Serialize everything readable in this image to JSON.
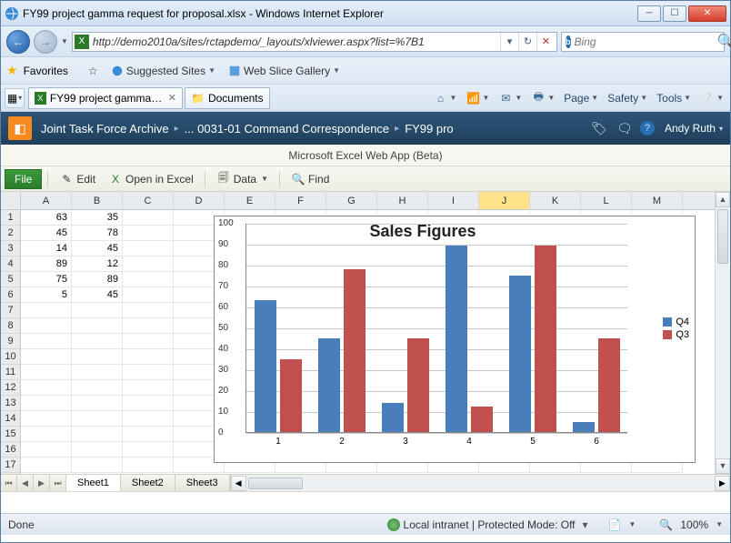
{
  "window": {
    "title": "FY99 project gamma request for proposal.xlsx - Windows Internet Explorer"
  },
  "address": {
    "url": "http://demo2010a/sites/rctapdemo/_layouts/xlviewer.aspx?list=%7B1"
  },
  "search": {
    "placeholder": "Bing"
  },
  "favorites": {
    "label": "Favorites",
    "suggested": "Suggested Sites",
    "webslice": "Web Slice Gallery"
  },
  "tabs": {
    "tab1": "FY99 project gamma re...",
    "tab2": "Documents"
  },
  "commandbar": {
    "page": "Page",
    "safety": "Safety",
    "tools": "Tools"
  },
  "sharepoint": {
    "bc1": "Joint Task Force Archive",
    "bc2": "... 0031-01 Command Correspondence",
    "bc3": "FY99 pro",
    "user": "Andy Ruth"
  },
  "app": {
    "title": "Microsoft Excel Web App (Beta)"
  },
  "toolbar": {
    "file": "File",
    "edit": "Edit",
    "openexcel": "Open in Excel",
    "data": "Data",
    "find": "Find"
  },
  "columns": [
    "A",
    "B",
    "C",
    "D",
    "E",
    "F",
    "G",
    "H",
    "I",
    "J",
    "K",
    "L",
    "M"
  ],
  "selected_col": "J",
  "row_labels": [
    "1",
    "2",
    "3",
    "4",
    "5",
    "6",
    "7",
    "8",
    "9",
    "10",
    "11",
    "12",
    "13",
    "14",
    "15",
    "16",
    "17"
  ],
  "cells": {
    "A": [
      "63",
      "45",
      "14",
      "89",
      "75",
      "5"
    ],
    "B": [
      "35",
      "78",
      "45",
      "12",
      "89",
      "45"
    ]
  },
  "chart_data": {
    "type": "bar",
    "title": "Sales Figures",
    "categories": [
      "1",
      "2",
      "3",
      "4",
      "5",
      "6"
    ],
    "series": [
      {
        "name": "Q4",
        "color": "#4a7ebb",
        "values": [
          63,
          45,
          14,
          89,
          75,
          5
        ]
      },
      {
        "name": "Q3",
        "color": "#c0504d",
        "values": [
          35,
          78,
          45,
          12,
          89,
          45
        ]
      }
    ],
    "ylim": [
      0,
      100
    ],
    "yticks": [
      0,
      10,
      20,
      30,
      40,
      50,
      60,
      70,
      80,
      90,
      100
    ]
  },
  "sheets": {
    "s1": "Sheet1",
    "s2": "Sheet2",
    "s3": "Sheet3"
  },
  "status": {
    "done": "Done",
    "zone": "Local intranet | Protected Mode: Off",
    "zoom": "100%"
  }
}
